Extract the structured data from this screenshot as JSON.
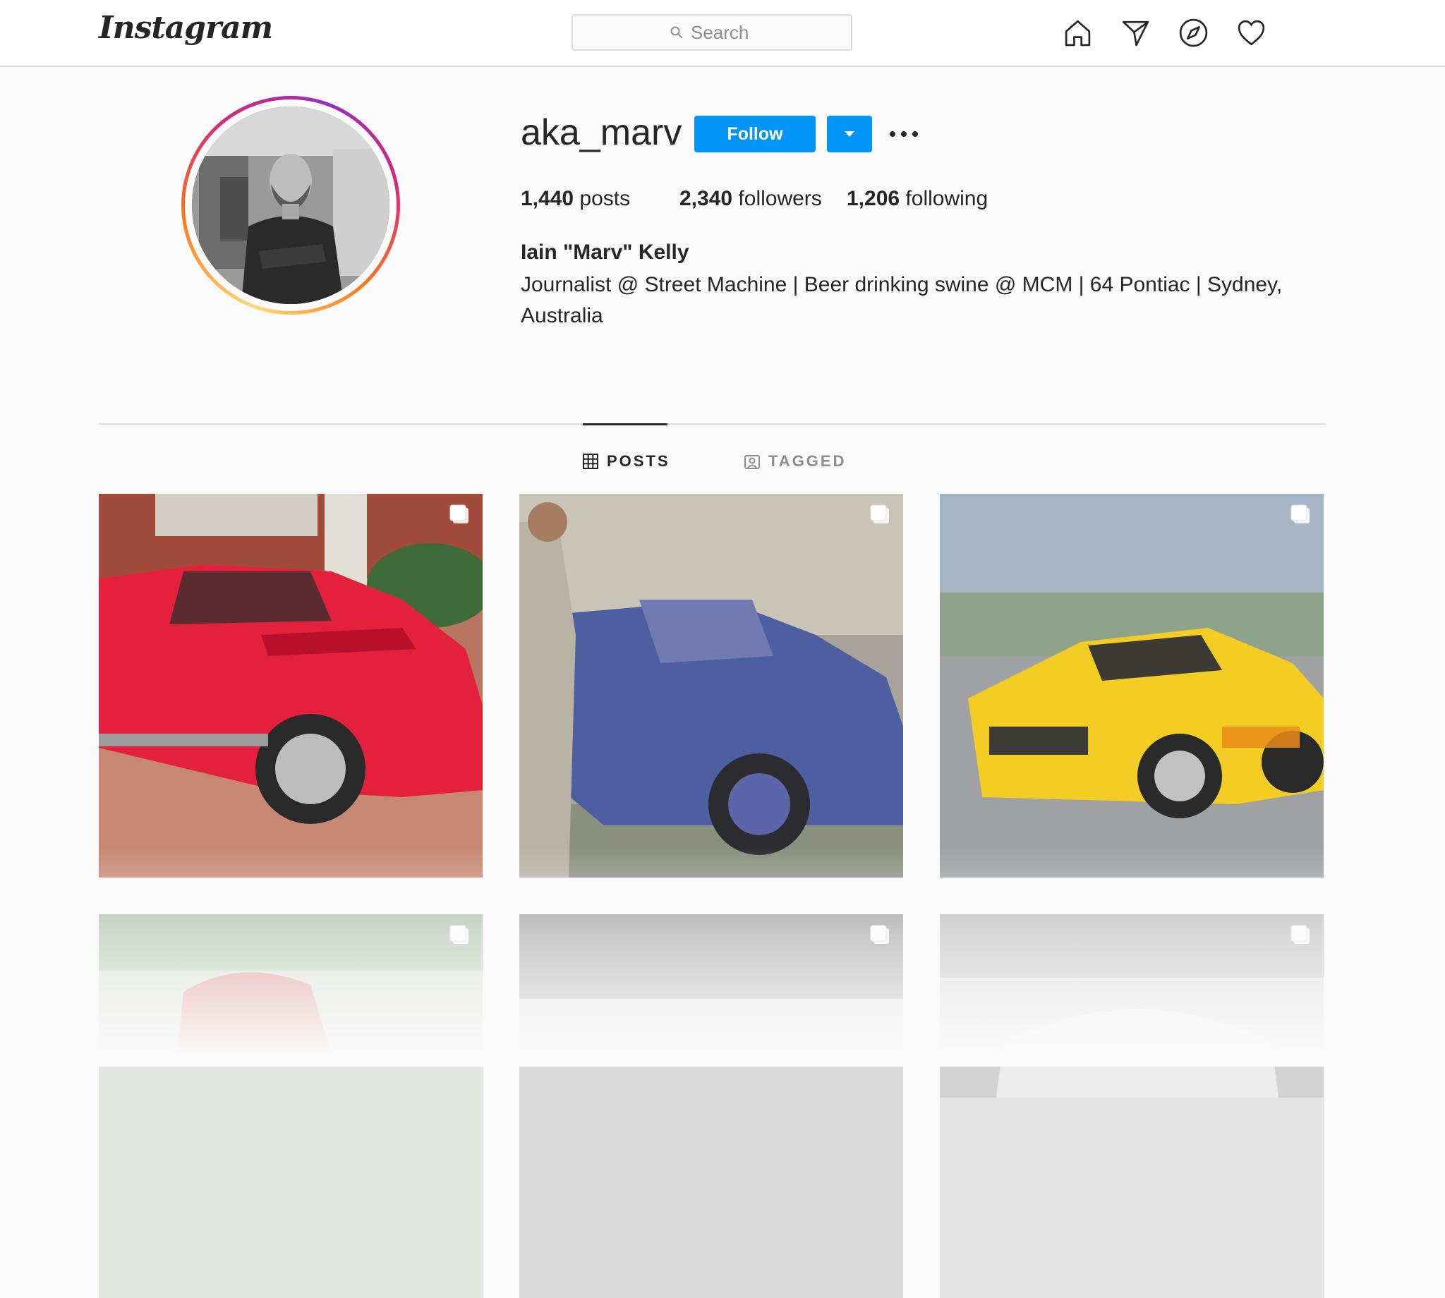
{
  "nav": {
    "logo": "Instagram",
    "search_placeholder": "Search",
    "icons": [
      "home-icon",
      "direct-icon",
      "explore-icon",
      "activity-icon"
    ]
  },
  "profile": {
    "username": "aka_marv",
    "follow_label": "Follow",
    "stats": {
      "posts_count": "1,440",
      "posts_label": "posts",
      "followers_count": "2,340",
      "followers_label": "followers",
      "following_count": "1,206",
      "following_label": "following"
    },
    "full_name": "Iain \"Marv\" Kelly",
    "bio": "Journalist @ Street Machine | Beer drinking swine @ MCM | 64 Pontiac | Sydney, Australia"
  },
  "tabs": [
    {
      "label": "POSTS",
      "icon": "grid-icon",
      "active": true
    },
    {
      "label": "TAGGED",
      "icon": "tagged-icon",
      "active": false
    }
  ],
  "posts": [
    {
      "subject": "red custom corvette",
      "multi": true
    },
    {
      "subject": "blue convertible with man",
      "multi": true
    },
    {
      "subject": "yellow bimoto race car",
      "multi": true
    },
    {
      "subject": "red car (faded)",
      "multi": true
    },
    {
      "subject": "grey photo (faded)",
      "multi": true
    },
    {
      "subject": "white race car (faded)",
      "multi": true
    }
  ],
  "colors": {
    "accent": "#0095f6",
    "text": "#262626",
    "muted": "#8e8e8e",
    "border": "#dbdbdb",
    "background": "#fafafa"
  }
}
